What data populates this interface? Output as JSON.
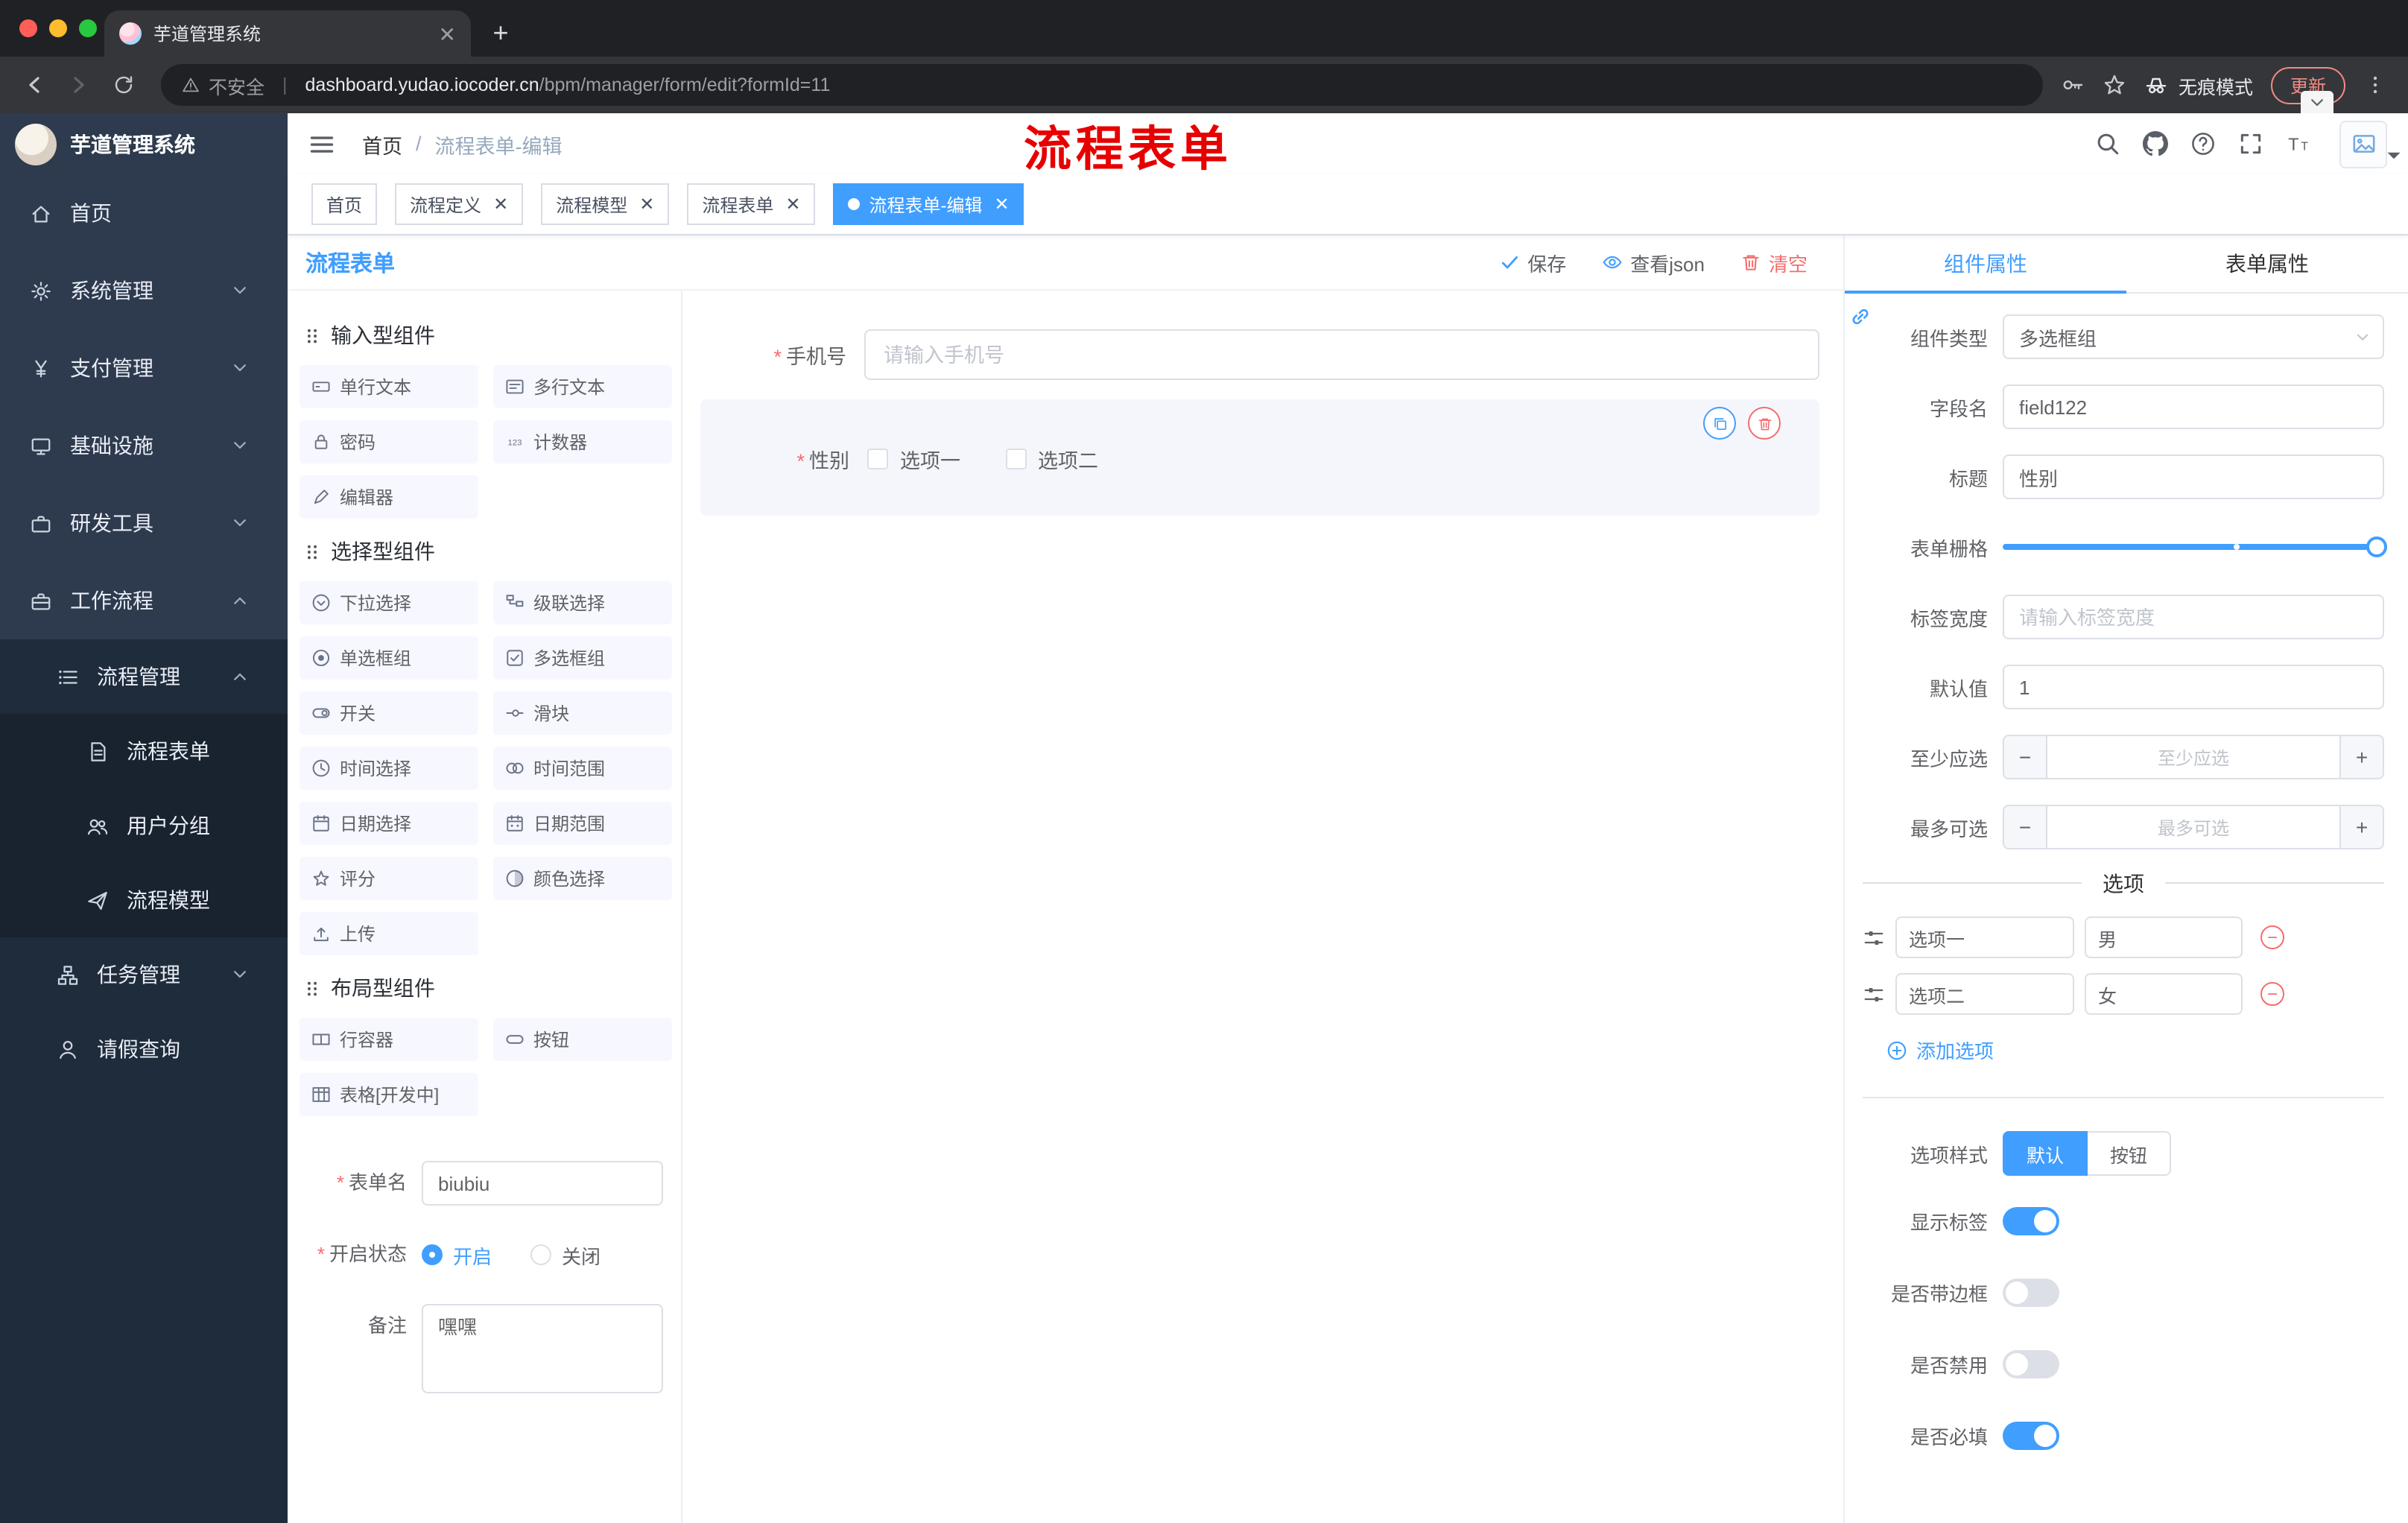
{
  "browser": {
    "tab": {
      "title": "芋道管理系统"
    },
    "address": {
      "security": "不安全",
      "host": "dashboard.yudao.iocoder.cn",
      "path": "/bpm/manager/form/edit?formId=11"
    },
    "incognito_label": "无痕模式",
    "update_label": "更新"
  },
  "annotation": {
    "text": "流程表单",
    "color": "#e60000"
  },
  "sidebar": {
    "logo_title": "芋道管理系统",
    "menu": [
      {
        "key": "home",
        "icon": "home-icon",
        "label": "首页"
      },
      {
        "key": "system",
        "icon": "gear-icon",
        "label": "系统管理",
        "chevron": "down"
      },
      {
        "key": "payment",
        "icon": "yen-icon",
        "label": "支付管理",
        "chevron": "down"
      },
      {
        "key": "infrastructure",
        "icon": "monitor-icon",
        "label": "基础设施",
        "chevron": "down"
      },
      {
        "key": "devtools",
        "icon": "toolbox-icon",
        "label": "研发工具",
        "chevron": "down"
      },
      {
        "key": "workflow",
        "icon": "briefcase-icon",
        "label": "工作流程",
        "chevron": "up",
        "children": [
          {
            "key": "process-mgmt",
            "icon": "list-icon",
            "label": "流程管理",
            "chevron": "up",
            "children": [
              {
                "key": "process-form",
                "icon": "doc-icon",
                "label": "流程表单",
                "active": true
              },
              {
                "key": "user-group",
                "icon": "users-icon",
                "label": "用户分组"
              },
              {
                "key": "process-model",
                "icon": "send-icon",
                "label": "流程模型"
              }
            ]
          },
          {
            "key": "task-mgmt",
            "icon": "tree-icon",
            "label": "任务管理",
            "chevron": "down"
          },
          {
            "key": "leave-query",
            "icon": "person-icon",
            "label": "请假查询"
          }
        ]
      }
    ]
  },
  "header": {
    "breadcrumb": [
      "首页",
      "流程表单-编辑"
    ]
  },
  "tags": [
    {
      "label": "首页",
      "closable": false,
      "active": false
    },
    {
      "label": "流程定义",
      "closable": true,
      "active": false
    },
    {
      "label": "流程模型",
      "closable": true,
      "active": false
    },
    {
      "label": "流程表单",
      "closable": true,
      "active": false
    },
    {
      "label": "流程表单-编辑",
      "closable": true,
      "active": true
    }
  ],
  "designer": {
    "panel_title": "流程表单",
    "toolbar": {
      "save": "保存",
      "view_json": "查看json",
      "clear": "清空"
    },
    "palette": [
      {
        "title": "输入型组件",
        "items": [
          {
            "icon": "input-icon",
            "label": "单行文本"
          },
          {
            "icon": "textarea-icon",
            "label": "多行文本"
          },
          {
            "icon": "lock-icon",
            "label": "密码"
          },
          {
            "icon": "counter-icon",
            "label": "计数器"
          },
          {
            "icon": "editor-icon",
            "label": "编辑器"
          }
        ]
      },
      {
        "title": "选择型组件",
        "items": [
          {
            "icon": "select-icon",
            "label": "下拉选择"
          },
          {
            "icon": "cascader-icon",
            "label": "级联选择"
          },
          {
            "icon": "radio-icon",
            "label": "单选框组"
          },
          {
            "icon": "checkbox-icon",
            "label": "多选框组"
          },
          {
            "icon": "switch-icon",
            "label": "开关"
          },
          {
            "icon": "slider-icon",
            "label": "滑块"
          },
          {
            "icon": "time-icon",
            "label": "时间选择"
          },
          {
            "icon": "time-range-icon",
            "label": "时间范围"
          },
          {
            "icon": "date-icon",
            "label": "日期选择"
          },
          {
            "icon": "date-range-icon",
            "label": "日期范围"
          },
          {
            "icon": "star-icon",
            "label": "评分"
          },
          {
            "icon": "color-icon",
            "label": "颜色选择"
          },
          {
            "icon": "upload-icon",
            "label": "上传"
          }
        ]
      },
      {
        "title": "布局型组件",
        "items": [
          {
            "icon": "row-icon",
            "label": "行容器"
          },
          {
            "icon": "button-icon",
            "label": "按钮"
          },
          {
            "icon": "table-icon",
            "label": "表格[开发中]"
          }
        ]
      }
    ],
    "meta_form": {
      "form_name_label": "表单名",
      "form_name_value": "biubiu",
      "status_label": "开启状态",
      "status_options": [
        "开启",
        "关闭"
      ],
      "status_selected": "开启",
      "remark_label": "备注",
      "remark_value": "嘿嘿"
    }
  },
  "canvas": {
    "phone": {
      "label": "手机号",
      "required": true,
      "placeholder": "请输入手机号"
    },
    "gender": {
      "label": "性别",
      "required": true,
      "options": [
        "选项一",
        "选项二"
      ]
    }
  },
  "inspector": {
    "tabs": [
      {
        "label": "组件属性",
        "active": true
      },
      {
        "label": "表单属性",
        "active": false
      }
    ],
    "fields": {
      "component_type": {
        "label": "组件类型",
        "value": "多选框组"
      },
      "field_name": {
        "label": "字段名",
        "value": "field122"
      },
      "title": {
        "label": "标题",
        "value": "性别"
      },
      "grid": {
        "label": "表单栅格"
      },
      "label_width": {
        "label": "标签宽度",
        "placeholder": "请输入标签宽度"
      },
      "default_value": {
        "label": "默认值",
        "value": "1"
      },
      "min_select": {
        "label": "至少应选",
        "placeholder": "至少应选"
      },
      "max_select": {
        "label": "最多可选",
        "placeholder": "最多可选"
      }
    },
    "options_divider": "选项",
    "options": [
      {
        "label": "选项一",
        "value": "男"
      },
      {
        "label": "选项二",
        "value": "女"
      }
    ],
    "add_option_label": "添加选项",
    "option_style": {
      "label": "选项样式",
      "choices": [
        "默认",
        "按钮"
      ],
      "selected": "默认"
    },
    "switches": [
      {
        "label": "显示标签",
        "on": true
      },
      {
        "label": "是否带边框",
        "on": false
      },
      {
        "label": "是否禁用",
        "on": false
      },
      {
        "label": "是否必填",
        "on": true
      }
    ]
  },
  "colors": {
    "primary": "#409eff",
    "danger": "#f56c6c",
    "annotation": "#e60000"
  }
}
